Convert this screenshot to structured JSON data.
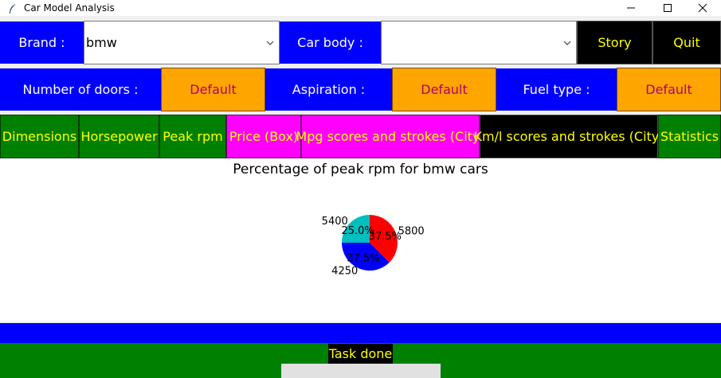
{
  "window": {
    "title": "Car Model Analysis"
  },
  "filters": {
    "brand_label": "Brand :",
    "brand_value": "bmw",
    "body_label": "Car body :",
    "body_value": "",
    "story_label": "Story",
    "quit_label": "Quit",
    "doors_label": "Number of doors :",
    "doors_value": "Default",
    "aspiration_label": "Aspiration :",
    "aspiration_value": "Default",
    "fuel_label": "Fuel type :",
    "fuel_value": "Default"
  },
  "tabs": [
    {
      "label": "Dimensions"
    },
    {
      "label": "Horsepower"
    },
    {
      "label": "Peak rpm"
    },
    {
      "label": "Price (Box)"
    },
    {
      "label": "Mpg scores and strokes (City)"
    },
    {
      "label": "Km/l scores and strokes (City)"
    },
    {
      "label": "Statistics"
    }
  ],
  "chart_data": {
    "type": "pie",
    "title": "Percentage of peak rpm for bmw cars",
    "slices": [
      {
        "label": "5800",
        "value": 37.5,
        "pct_label": "37.5%",
        "color": "#ff0000"
      },
      {
        "label": "4250",
        "value": 37.5,
        "pct_label": "37.5%",
        "color": "#0000ff"
      },
      {
        "label": "5400",
        "value": 25.0,
        "pct_label": "25.0%",
        "color": "#00bfbf"
      }
    ]
  },
  "status": {
    "text": "Task done"
  },
  "colors": {
    "blue": "#0000ff",
    "orange": "#ffa500",
    "green": "#008000",
    "magenta": "#ff00ff",
    "black": "#000000",
    "yellow": "#ffff00"
  }
}
